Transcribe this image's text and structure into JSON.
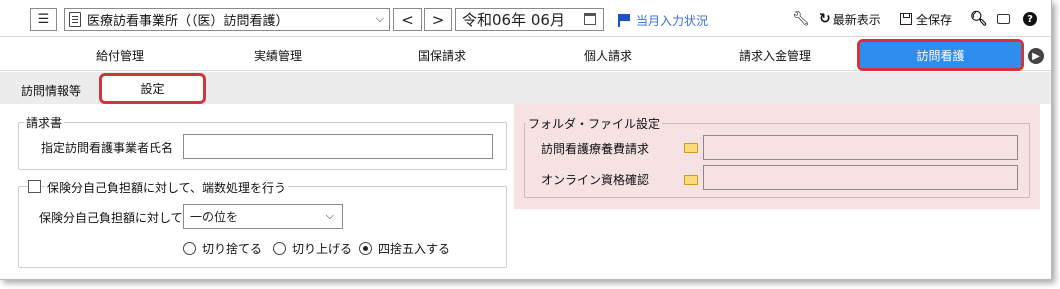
{
  "toolbar": {
    "office_select": "医療訪看事業所（（医）訪問看護）",
    "prev_label": "<",
    "next_label": ">",
    "date_value": "令和06年 06月",
    "flag_link": "当月入力状況",
    "refresh_label": "最新表示",
    "save_label": "全保存"
  },
  "main_tabs": [
    "給付管理",
    "実績管理",
    "国保請求",
    "個人請求",
    "請求入金管理",
    "訪問看護"
  ],
  "sub_tabs": [
    "訪問情報等",
    "設定"
  ],
  "billing_group": {
    "legend": "請求書",
    "provider_name_label": "指定訪問看護事業者氏名",
    "provider_name_value": ""
  },
  "rounding_group": {
    "checkbox_label": "保険分自己負担額に対して、端数処理を行う",
    "target_label": "保険分自己負担額に対して",
    "target_select": "一の位を",
    "options": [
      "切り捨てる",
      "切り上げる",
      "四捨五入する"
    ],
    "selected": "四捨五入する"
  },
  "folder_group": {
    "legend": "フォルダ・ファイル設定",
    "row1_label": "訪問看護療養費請求",
    "row1_value": "",
    "row2_label": "オンライン資格確認",
    "row2_value": ""
  },
  "colors": {
    "active_tab": "#2e8ef0",
    "highlight": "#d2343c",
    "pink_panel": "#f6e1e3",
    "link": "#3a6fd8"
  }
}
